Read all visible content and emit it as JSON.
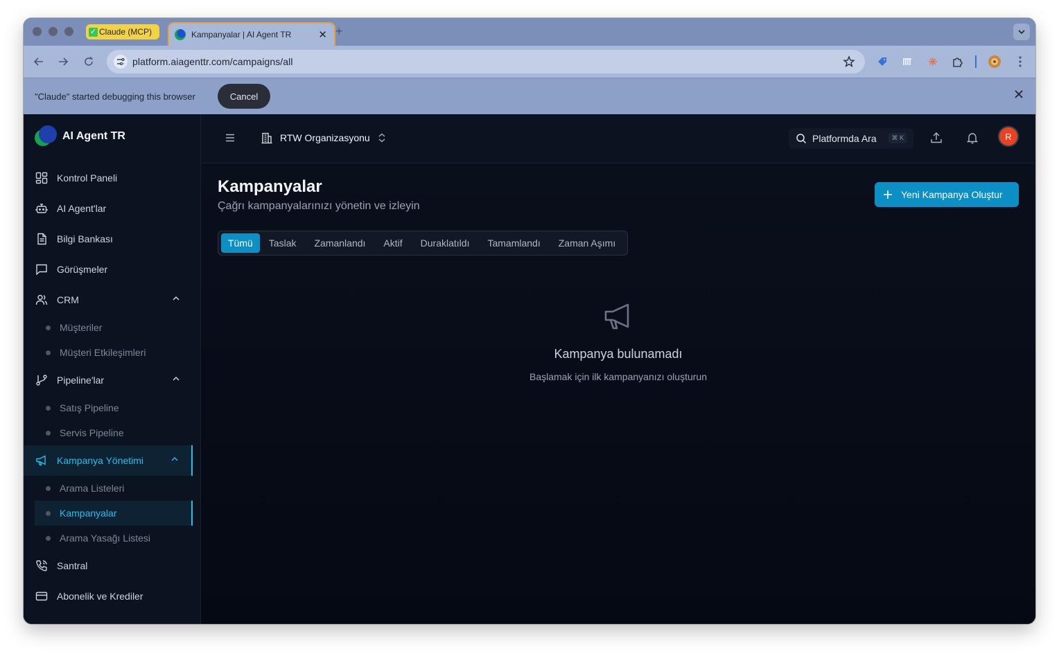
{
  "browser": {
    "tabs": [
      {
        "label": "Claude (MCP)"
      },
      {
        "label": "Kampanyalar | AI Agent TR"
      }
    ],
    "url": "platform.aiagenttr.com/campaigns/all",
    "infobar": {
      "message": "\"Claude\" started debugging this browser",
      "cancel_label": "Cancel"
    }
  },
  "app": {
    "brand": "AI Agent TR",
    "org_name": "RTW Organizasyonu",
    "search": {
      "label": "Platformda Ara",
      "shortcut": "⌘ K"
    },
    "avatar_initial": "R",
    "sidebar": {
      "items": [
        {
          "label": "Kontrol Paneli",
          "icon": "dashboard-icon"
        },
        {
          "label": "AI Agent'lar",
          "icon": "bot-icon"
        },
        {
          "label": "Bilgi Bankası",
          "icon": "document-icon"
        },
        {
          "label": "Görüşmeler",
          "icon": "chat-icon"
        },
        {
          "label": "CRM",
          "icon": "users-icon",
          "expanded": true,
          "children": [
            "Müşteriler",
            "Müşteri Etkileşimleri"
          ]
        },
        {
          "label": "Pipeline'lar",
          "icon": "branch-icon",
          "expanded": true,
          "children": [
            "Satış Pipeline",
            "Servis Pipeline"
          ]
        },
        {
          "label": "Kampanya Yönetimi",
          "icon": "megaphone-icon",
          "expanded": true,
          "active": true,
          "children": [
            "Arama Listeleri",
            "Kampanyalar",
            "Arama Yasağı Listesi"
          ],
          "active_child": "Kampanyalar"
        },
        {
          "label": "Santral",
          "icon": "phone-icon"
        },
        {
          "label": "Abonelik ve Krediler",
          "icon": "credit-card-icon"
        }
      ]
    },
    "page": {
      "title": "Kampanyalar",
      "subtitle": "Çağrı kampanyalarınızı yönetin ve izleyin",
      "create_button": "Yeni Kampanya Oluştur",
      "filter_tabs": [
        "Tümü",
        "Taslak",
        "Zamanlandı",
        "Aktif",
        "Duraklatıldı",
        "Tamamlandı",
        "Zaman Aşımı"
      ],
      "selected_tab": "Tümü",
      "empty_state": {
        "title": "Kampanya bulunamadı",
        "subtitle": "Başlamak için ilk kampanyanızı oluşturun"
      }
    },
    "colors": {
      "accent": "#22c0e8",
      "primary_button": "#0b8fc4",
      "background": "#060b16",
      "avatar": "#e8431e"
    }
  }
}
